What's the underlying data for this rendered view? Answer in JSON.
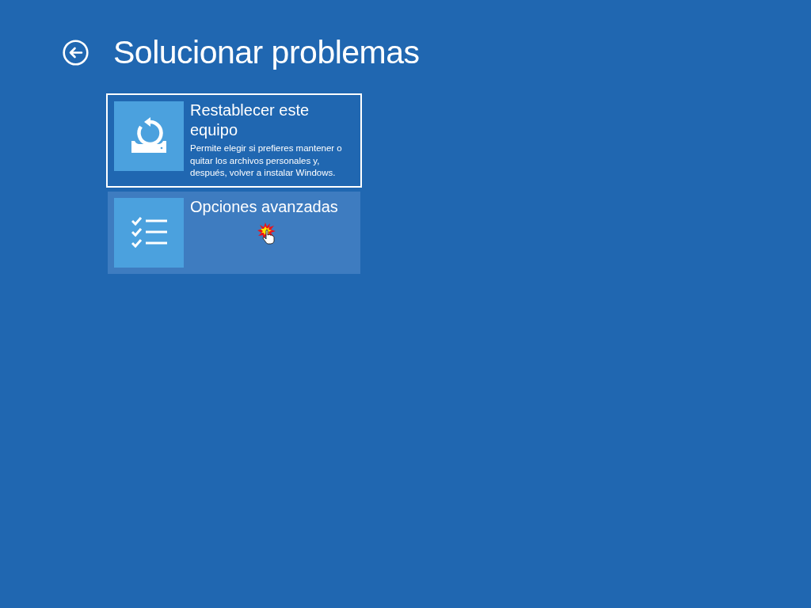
{
  "header": {
    "title": "Solucionar problemas"
  },
  "options": [
    {
      "kind": "reset",
      "title": "Restablecer este equipo",
      "description": "Permite elegir si prefieres mantener o quitar los archivos personales y, después, volver a instalar Windows.",
      "focused": true,
      "hovered": false
    },
    {
      "kind": "advanced",
      "title": "Opciones avanzadas",
      "focused": false,
      "hovered": true
    }
  ]
}
